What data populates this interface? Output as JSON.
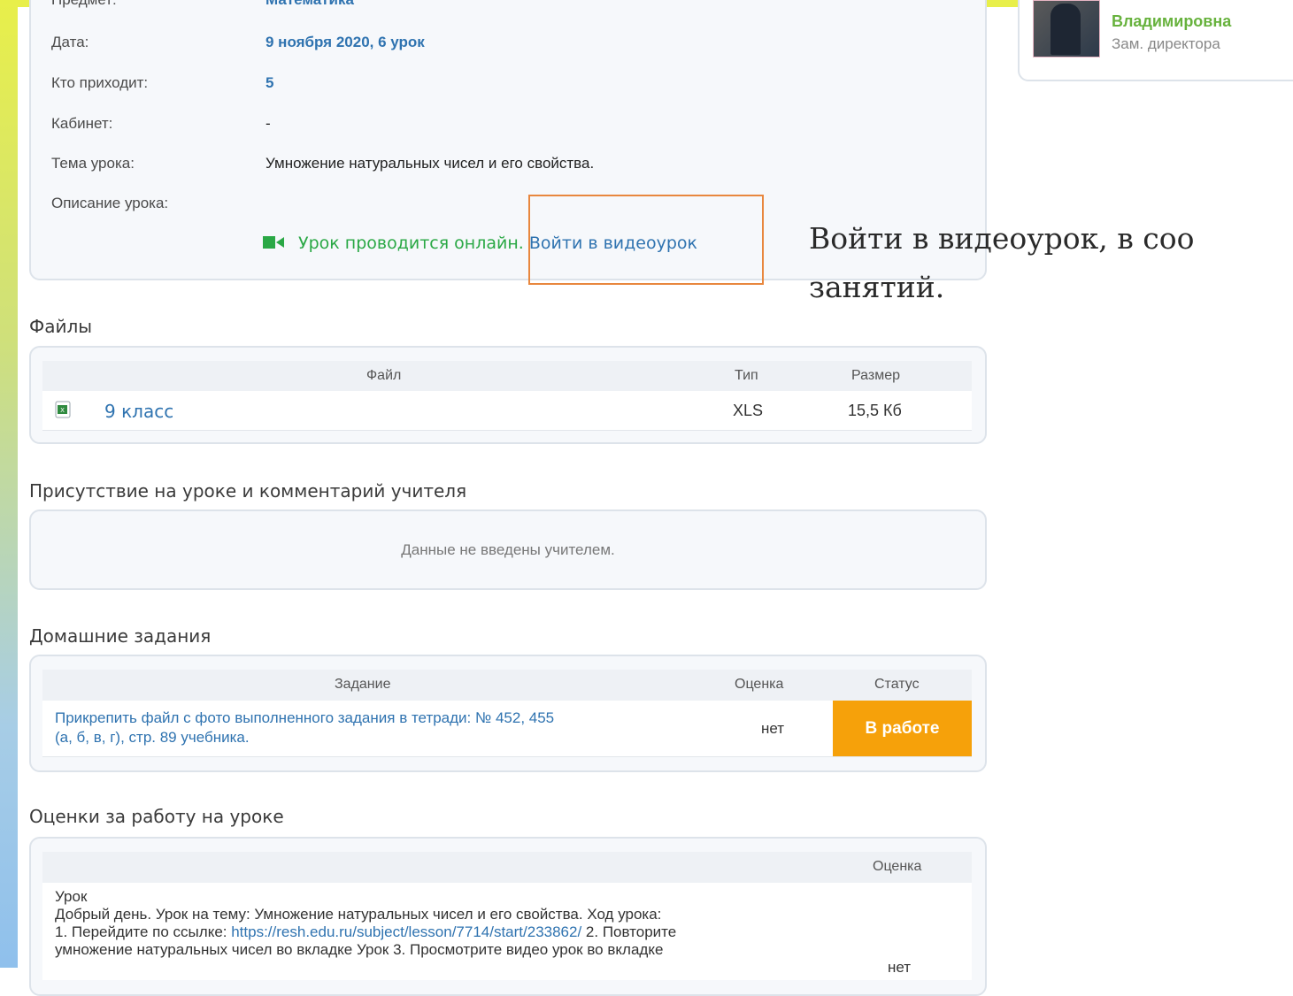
{
  "lesson": {
    "subject_label": "Предмет:",
    "subject_value": "Математика",
    "date_label": "Дата:",
    "date_value": "9 ноября 2020, 6 урок",
    "attendees_label": "Кто приходит:",
    "attendees_value": "5",
    "room_label": "Кабинет:",
    "room_value": "-",
    "topic_label": "Тема урока:",
    "topic_value": "Умножение натуральных чисел и его свойства.",
    "description_label": "Описание урока:",
    "online_text": "Урок проводится онлайн.",
    "online_link": "Войти в видеоурок"
  },
  "annotation": {
    "line1": "Войти в видеоурок, в соо",
    "line2": "занятий."
  },
  "profile": {
    "name": "Владимировна",
    "role": "Зам. директора"
  },
  "files": {
    "title": "Файлы",
    "headers": [
      "Файл",
      "Тип",
      "Размер"
    ],
    "rows": [
      {
        "name": "9 класс",
        "type": "XLS",
        "size": "15,5 Кб"
      }
    ]
  },
  "attendance": {
    "title": "Присутствие на уроке и комментарий учителя",
    "empty_text": "Данные не введены учителем."
  },
  "homework": {
    "title": "Домашние задания",
    "headers": [
      "Задание",
      "Оценка",
      "Статус"
    ],
    "rows": [
      {
        "task_line1": "Прикрепить файл с фото выполненного задания в тетради: № 452, 455",
        "task_line2": "(а, б, в, г), стр. 89 учебника.",
        "grade": "нет",
        "status": "В работе"
      }
    ],
    "status_color": "#f6a10a"
  },
  "grades": {
    "title": "Оценки за работу на уроке",
    "header_grade": "Оценка",
    "rows": [
      {
        "type": "Урок",
        "line1": "Добрый день. Урок на тему: Умножение натуральных чисел и его свойства. Ход урока:",
        "line2_prefix": "1. Перейдите по ссылке: ",
        "line2_link": "https://resh.edu.ru/subject/lesson/7714/start/233862/",
        "line2_suffix": " 2. Повторите",
        "line3": "умножение натуральных чисел во вкладке Урок 3. Просмотрите видео урок во вкладке",
        "grade": "нет"
      }
    ]
  }
}
